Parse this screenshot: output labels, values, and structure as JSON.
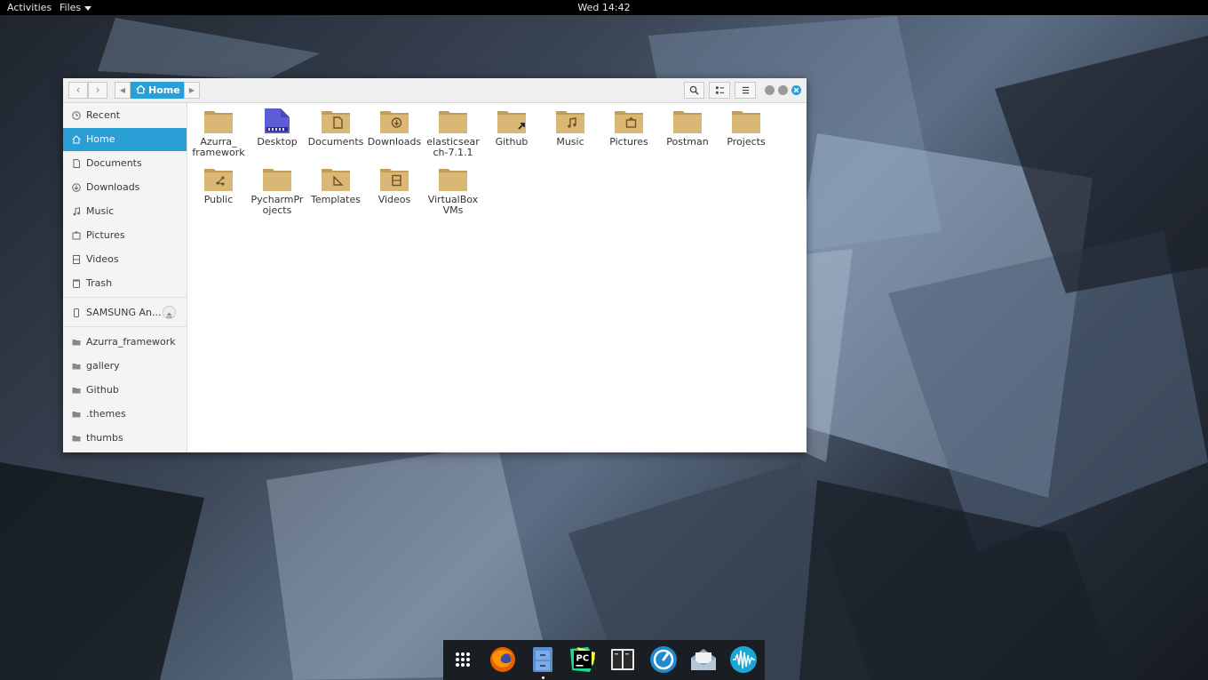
{
  "topbar": {
    "activities": "Activities",
    "app_menu": "Files",
    "clock": "Wed 14:42"
  },
  "window": {
    "breadcrumb": {
      "current": "Home"
    },
    "sidebar": {
      "places": [
        {
          "label": "Recent",
          "icon": "clock-icon"
        },
        {
          "label": "Home",
          "icon": "home-icon",
          "active": true
        },
        {
          "label": "Documents",
          "icon": "document-icon"
        },
        {
          "label": "Downloads",
          "icon": "download-icon"
        },
        {
          "label": "Music",
          "icon": "music-icon"
        },
        {
          "label": "Pictures",
          "icon": "picture-icon"
        },
        {
          "label": "Videos",
          "icon": "film-icon"
        },
        {
          "label": "Trash",
          "icon": "trash-icon"
        }
      ],
      "device": {
        "label": "SAMSUNG An...",
        "icon": "phone-icon"
      },
      "bookmarks": [
        {
          "label": "Azurra_framework"
        },
        {
          "label": "gallery"
        },
        {
          "label": "Github"
        },
        {
          "label": ".themes"
        },
        {
          "label": "thumbs"
        }
      ]
    },
    "files": [
      {
        "name": "Azurra_\nframework",
        "emblem": "none"
      },
      {
        "name": "Desktop",
        "emblem": "desktop"
      },
      {
        "name": "Documents",
        "emblem": "document"
      },
      {
        "name": "Downloads",
        "emblem": "download"
      },
      {
        "name": "elasticsear\nch-7.1.1",
        "emblem": "none"
      },
      {
        "name": "Github",
        "emblem": "link"
      },
      {
        "name": "Music",
        "emblem": "music"
      },
      {
        "name": "Pictures",
        "emblem": "picture"
      },
      {
        "name": "Postman",
        "emblem": "none"
      },
      {
        "name": "Projects",
        "emblem": "none"
      },
      {
        "name": "Public",
        "emblem": "share"
      },
      {
        "name": "PycharmPr\nojects",
        "emblem": "none"
      },
      {
        "name": "Templates",
        "emblem": "template"
      },
      {
        "name": "Videos",
        "emblem": "film"
      },
      {
        "name": "VirtualBox\nVMs",
        "emblem": "none"
      }
    ]
  },
  "dock": {
    "apps": [
      {
        "name": "show-applications-icon"
      },
      {
        "name": "firefox-icon"
      },
      {
        "name": "files-icon",
        "running": true
      },
      {
        "name": "pycharm-icon",
        "text": "PC"
      },
      {
        "name": "terminal-icon"
      },
      {
        "name": "timer-icon"
      },
      {
        "name": "mail-icon"
      },
      {
        "name": "audio-wave-icon"
      }
    ]
  },
  "colors": {
    "accent": "#2a9fd6",
    "folder": "#d9b877",
    "folder_dark": "#c49d55"
  }
}
